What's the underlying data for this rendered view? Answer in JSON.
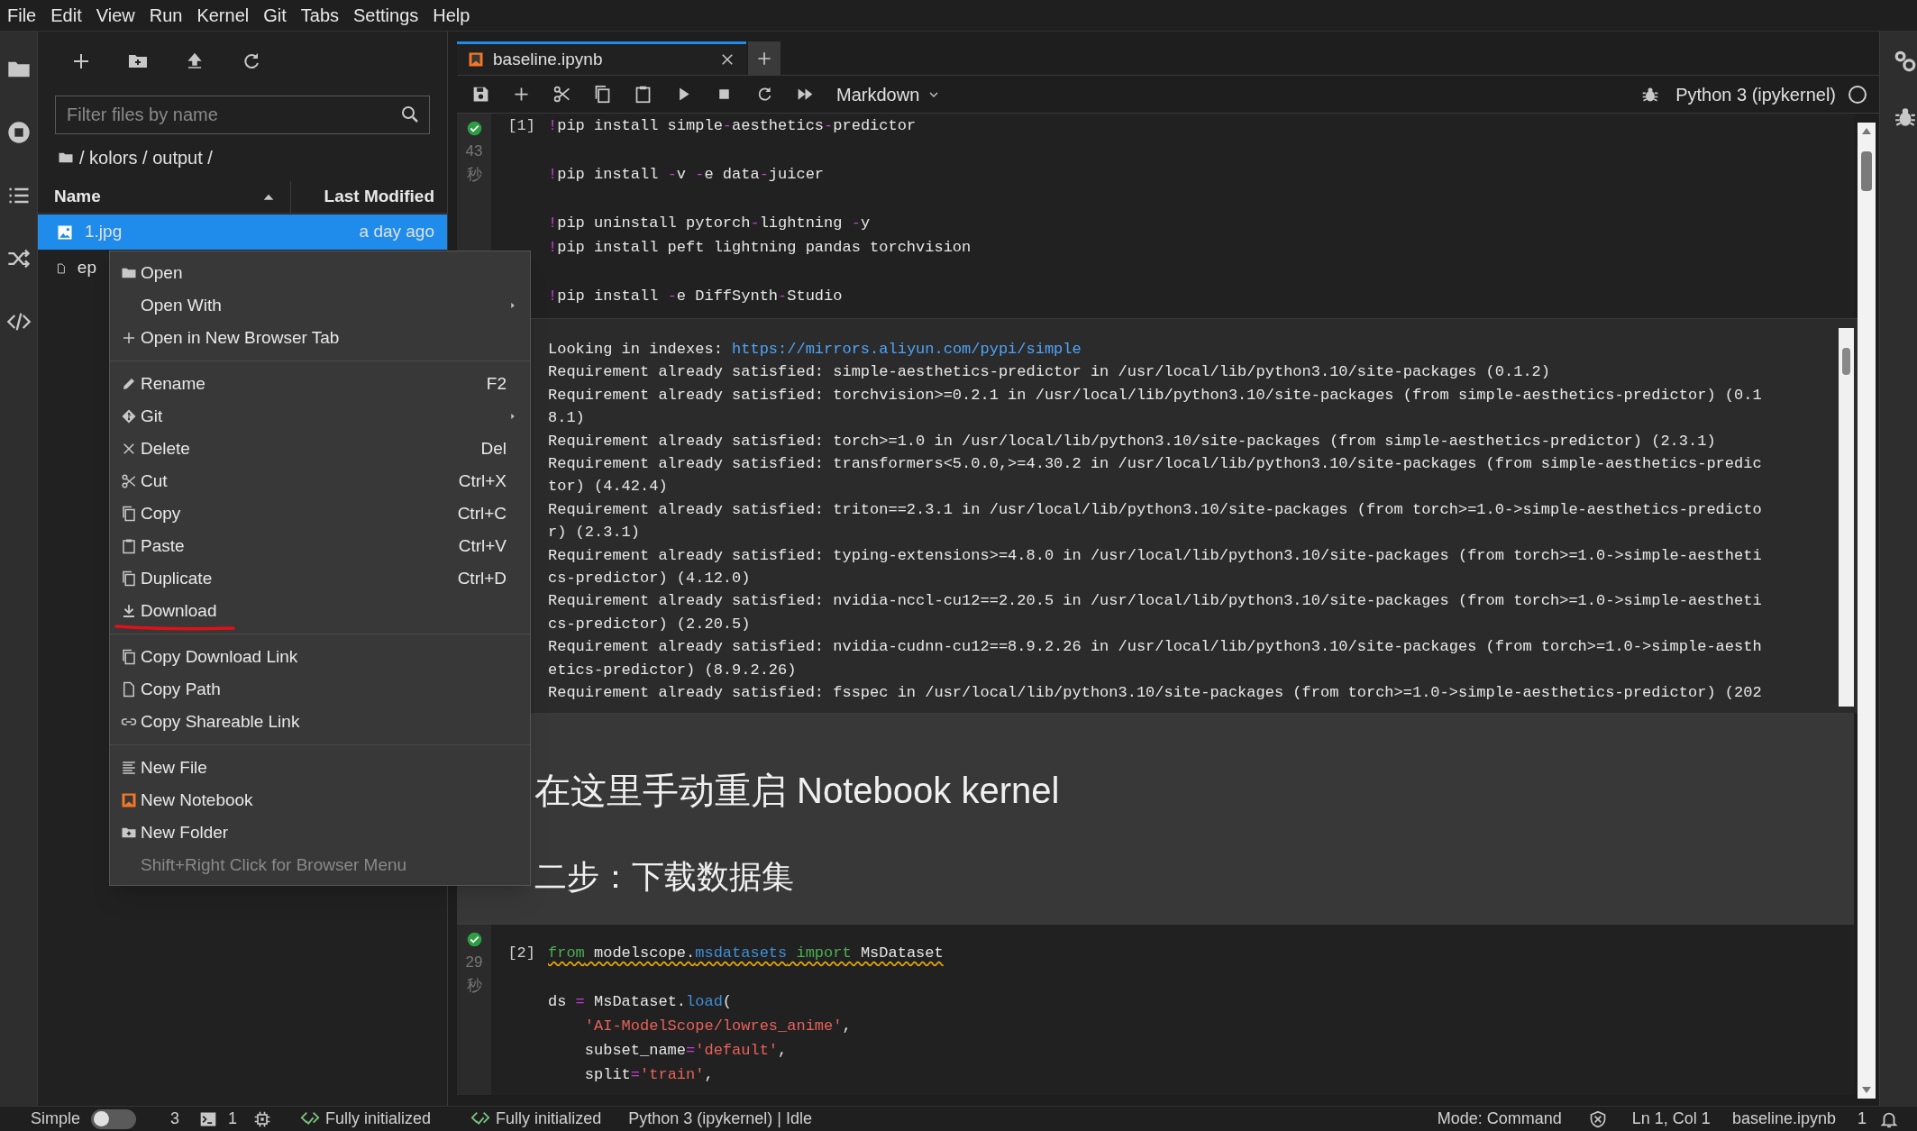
{
  "menubar": [
    "File",
    "Edit",
    "View",
    "Run",
    "Kernel",
    "Git",
    "Tabs",
    "Settings",
    "Help"
  ],
  "file_browser": {
    "filter": {
      "placeholder": "Filter files by name"
    },
    "path": "/ kolors / output /",
    "columns": [
      {
        "label": "Name",
        "sorted": true
      },
      {
        "label": "Last Modified",
        "sorted": false
      }
    ],
    "files": [
      {
        "name": "1.jpg",
        "modified": "a day ago",
        "selected": true,
        "kind": "image"
      },
      {
        "name": "ep",
        "selected": false,
        "kind": "file"
      }
    ]
  },
  "context_menu": [
    {
      "kind": "item",
      "label": "Open",
      "disabled": false,
      "submenu": false
    },
    {
      "kind": "item",
      "label": "Open With",
      "submenu": true,
      "disabled": false
    },
    {
      "kind": "item",
      "label": "Open in New Browser Tab",
      "disabled": false,
      "submenu": false
    },
    {
      "kind": "separator"
    },
    {
      "kind": "item",
      "label": "Rename",
      "shortcut": "F2",
      "disabled": false,
      "submenu": false
    },
    {
      "kind": "item",
      "label": "Git",
      "submenu": true,
      "disabled": false
    },
    {
      "kind": "item",
      "label": "Delete",
      "shortcut": "Del",
      "disabled": false,
      "submenu": false
    },
    {
      "kind": "item",
      "label": "Cut",
      "shortcut": "Ctrl+X",
      "disabled": false,
      "submenu": false
    },
    {
      "kind": "item",
      "label": "Copy",
      "shortcut": "Ctrl+C",
      "disabled": false,
      "submenu": false
    },
    {
      "kind": "item",
      "label": "Paste",
      "shortcut": "Ctrl+V",
      "disabled": false,
      "submenu": false
    },
    {
      "kind": "item",
      "label": "Duplicate",
      "shortcut": "Ctrl+D",
      "disabled": false,
      "submenu": false
    },
    {
      "kind": "item",
      "label": "Download",
      "disabled": false,
      "submenu": false,
      "marked": true
    },
    {
      "kind": "separator"
    },
    {
      "kind": "item",
      "label": "Copy Download Link",
      "disabled": false,
      "submenu": false
    },
    {
      "kind": "item",
      "label": "Copy Path",
      "disabled": false,
      "submenu": false
    },
    {
      "kind": "item",
      "label": "Copy Shareable Link",
      "disabled": false,
      "submenu": false
    },
    {
      "kind": "separator"
    },
    {
      "kind": "item",
      "label": "New File",
      "disabled": false,
      "submenu": false
    },
    {
      "kind": "item",
      "label": "New Notebook",
      "disabled": false,
      "submenu": false
    },
    {
      "kind": "item",
      "label": "New Folder",
      "disabled": false,
      "submenu": false
    },
    {
      "kind": "item",
      "label": "Shift+Right Click for Browser Menu",
      "disabled": true,
      "submenu": false
    }
  ],
  "notebook": {
    "tabs": [
      {
        "title": "baseline.ipynb",
        "selected": true
      }
    ],
    "cell_type": "Markdown",
    "kernel": "Python 3 (ipykernel)",
    "kernel_busy": false,
    "cells": [
      {
        "kind": "code",
        "prompt": "[1]",
        "succeeded": true,
        "time": "43",
        "time_unit": "秒",
        "lines": [
          {
            "kind": "code",
            "warning": false,
            "segs": [
              {
                "kind": "op",
                "text": "!"
              },
              {
                "kind": "plain",
                "text": "pip install simple"
              },
              {
                "kind": "op",
                "text": "-"
              },
              {
                "kind": "plain",
                "text": "aesthetics"
              },
              {
                "kind": "op",
                "text": "-"
              },
              {
                "kind": "plain",
                "text": "predictor"
              }
            ]
          },
          {
            "kind": "blank"
          },
          {
            "kind": "code",
            "warning": false,
            "segs": [
              {
                "kind": "op",
                "text": "!"
              },
              {
                "kind": "plain",
                "text": "pip install "
              },
              {
                "kind": "op",
                "text": "-"
              },
              {
                "kind": "plain",
                "text": "v "
              },
              {
                "kind": "op",
                "text": "-"
              },
              {
                "kind": "plain",
                "text": "e data"
              },
              {
                "kind": "op",
                "text": "-"
              },
              {
                "kind": "plain",
                "text": "juicer"
              }
            ]
          },
          {
            "kind": "blank"
          },
          {
            "kind": "code",
            "warning": false,
            "segs": [
              {
                "kind": "op",
                "text": "!"
              },
              {
                "kind": "plain",
                "text": "pip uninstall pytorch"
              },
              {
                "kind": "op",
                "text": "-"
              },
              {
                "kind": "plain",
                "text": "lightning "
              },
              {
                "kind": "op",
                "text": "-"
              },
              {
                "kind": "plain",
                "text": "y"
              }
            ]
          },
          {
            "kind": "code",
            "warning": false,
            "segs": [
              {
                "kind": "op",
                "text": "!"
              },
              {
                "kind": "plain",
                "text": "pip install peft lightning pandas torchvision"
              }
            ]
          },
          {
            "kind": "blank"
          },
          {
            "kind": "code",
            "warning": false,
            "segs": [
              {
                "kind": "op",
                "text": "!"
              },
              {
                "kind": "plain",
                "text": "pip install "
              },
              {
                "kind": "op",
                "text": "-"
              },
              {
                "kind": "plain",
                "text": "e DiffSynth"
              },
              {
                "kind": "op",
                "text": "-"
              },
              {
                "kind": "plain",
                "text": "Studio"
              }
            ]
          }
        ],
        "output": {
          "index_label": "Looking in indexes: ",
          "index_link": "https://mirrors.aliyun.com/pypi/simple",
          "lines": [
            "Requirement already satisfied: simple-aesthetics-predictor in /usr/local/lib/python3.10/site-packages (0.1.2)",
            "Requirement already satisfied: torchvision>=0.2.1 in /usr/local/lib/python3.10/site-packages (from simple-aesthetics-predictor) (0.18.1)",
            "Requirement already satisfied: torch>=1.0 in /usr/local/lib/python3.10/site-packages (from simple-aesthetics-predictor) (2.3.1)",
            "Requirement already satisfied: transformers<5.0.0,>=4.30.2 in /usr/local/lib/python3.10/site-packages (from simple-aesthetics-predictor) (4.42.4)",
            "Requirement already satisfied: triton==2.3.1 in /usr/local/lib/python3.10/site-packages (from torch>=1.0->simple-aesthetics-predictor) (2.3.1)",
            "Requirement already satisfied: typing-extensions>=4.8.0 in /usr/local/lib/python3.10/site-packages (from torch>=1.0->simple-aesthetics-predictor) (4.12.0)",
            "Requirement already satisfied: nvidia-nccl-cu12==2.20.5 in /usr/local/lib/python3.10/site-packages (from torch>=1.0->simple-aesthetics-predictor) (2.20.5)",
            "Requirement already satisfied: nvidia-cudnn-cu12==8.9.2.26 in /usr/local/lib/python3.10/site-packages (from torch>=1.0->simple-aesthetics-predictor) (8.9.2.26)",
            "Requirement already satisfied: fsspec in /usr/local/lib/python3.10/site-packages (from torch>=1.0->simple-aesthetics-predictor) (202"
          ]
        }
      },
      {
        "kind": "markdown",
        "headings": [
          {
            "text": "在这里手动重启 Notebook kernel",
            "kind": "h1"
          },
          {
            "text": "二步：下载数据集",
            "kind": "h2"
          }
        ]
      },
      {
        "kind": "code",
        "prompt": "[2]",
        "succeeded": true,
        "time": "29",
        "time_unit": "秒",
        "lines": [
          {
            "kind": "code",
            "warning": true,
            "segs": [
              {
                "kind": "keyword",
                "text": "from"
              },
              {
                "kind": "plain",
                "text": " modelscope."
              },
              {
                "kind": "module",
                "text": "msdatasets"
              },
              {
                "kind": "keyword",
                "text": " import"
              },
              {
                "kind": "plain",
                "text": " MsDataset"
              }
            ]
          },
          {
            "kind": "blank"
          },
          {
            "kind": "code",
            "warning": false,
            "segs": [
              {
                "kind": "plain",
                "text": "ds "
              },
              {
                "kind": "op",
                "text": "="
              },
              {
                "kind": "plain",
                "text": " MsDataset."
              },
              {
                "kind": "module",
                "text": "load"
              },
              {
                "kind": "plain",
                "text": "("
              }
            ]
          },
          {
            "kind": "code",
            "warning": false,
            "segs": [
              {
                "kind": "string",
                "text": "    'AI-ModelScope/lowres_anime'"
              },
              {
                "kind": "plain",
                "text": ","
              }
            ]
          },
          {
            "kind": "code",
            "warning": false,
            "segs": [
              {
                "kind": "plain",
                "text": "    subset_name"
              },
              {
                "kind": "op",
                "text": "="
              },
              {
                "kind": "string",
                "text": "'default'"
              },
              {
                "kind": "plain",
                "text": ","
              }
            ]
          },
          {
            "kind": "code",
            "warning": false,
            "segs": [
              {
                "kind": "plain",
                "text": "    split"
              },
              {
                "kind": "op",
                "text": "="
              },
              {
                "kind": "string",
                "text": "'train'"
              },
              {
                "kind": "plain",
                "text": ","
              }
            ]
          }
        ]
      }
    ]
  },
  "status_bar": {
    "mode_label": "Simple",
    "simple_mode": false,
    "terminals": "3",
    "kernels": "1",
    "lsp_status": [
      "Fully initialized",
      "Fully initialized"
    ],
    "kernel_status": "Python 3 (ipykernel) | Idle",
    "mode": "Mode: Command",
    "position": "Ln 1, Col 1",
    "file": "baseline.ipynb",
    "notifications": "1"
  }
}
